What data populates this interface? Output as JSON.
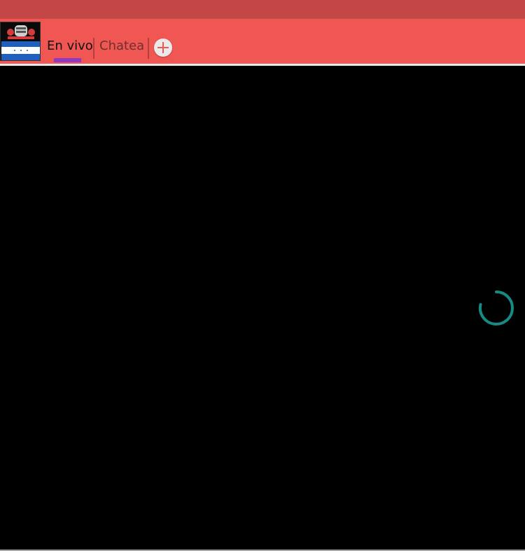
{
  "tabs": {
    "live_label": "En vivo",
    "chat_label": "Chatea"
  },
  "icons": {
    "logo": "radio-logo-flag-icon",
    "add": "plus-circle-icon",
    "loading": "loading-spinner-icon"
  },
  "colors": {
    "status_bar": "#c24746",
    "app_bar": "#f05753",
    "active_tab_indicator": "#8e3ac7",
    "spinner": "#168b86",
    "player_background": "#000000"
  }
}
